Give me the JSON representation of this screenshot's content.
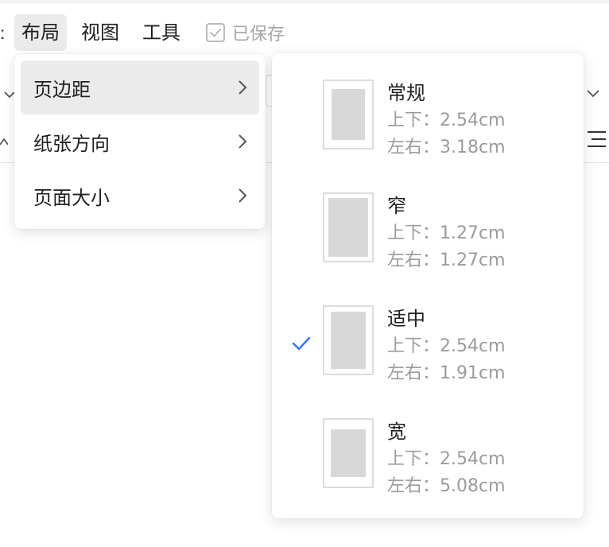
{
  "menubar": {
    "left_fragment": "ː",
    "items": [
      {
        "label": "布局",
        "active": true
      },
      {
        "label": "视图",
        "active": false
      },
      {
        "label": "工具",
        "active": false
      }
    ],
    "saved_label": "已保存"
  },
  "dropdown": {
    "items": [
      {
        "label": "页边距",
        "active": true
      },
      {
        "label": "纸张方向",
        "active": false
      },
      {
        "label": "页面大小",
        "active": false
      }
    ]
  },
  "margins": {
    "options": [
      {
        "name": "常规",
        "top_bottom": "上下：2.54cm",
        "left_right": "左右：3.18cm",
        "selected": false
      },
      {
        "name": "窄",
        "top_bottom": "上下：1.27cm",
        "left_right": "左右：1.27cm",
        "selected": false
      },
      {
        "name": "适中",
        "top_bottom": "上下：2.54cm",
        "left_right": "左右：1.91cm",
        "selected": true
      },
      {
        "name": "宽",
        "top_bottom": "上下：2.54cm",
        "left_right": "左右：5.08cm",
        "selected": false
      }
    ]
  },
  "colors": {
    "check": "#3370ff",
    "active_bg": "#ebebeb",
    "muted_text": "#9b9b9b"
  },
  "icons": {
    "saved": "checkbox-check-icon",
    "chevron": "chevron-right-icon",
    "selected": "checkmark-icon",
    "list": "list-icon"
  }
}
